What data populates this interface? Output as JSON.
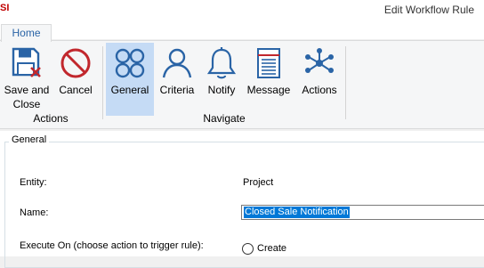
{
  "app": {
    "logo": "SI",
    "window_title": "Edit Workflow Rule"
  },
  "tabs": [
    {
      "label": "Home"
    }
  ],
  "ribbon": {
    "groups": {
      "actions": {
        "label": "Actions",
        "buttons": {
          "save_close": {
            "line1": "Save and",
            "line2": "Close",
            "icon": "save-close-icon"
          },
          "cancel": {
            "label": "Cancel",
            "icon": "cancel-icon"
          }
        }
      },
      "navigate": {
        "label": "Navigate",
        "buttons": {
          "general": {
            "label": "General",
            "icon": "general-icon",
            "selected": true
          },
          "criteria": {
            "label": "Criteria",
            "icon": "person-icon"
          },
          "notify": {
            "label": "Notify",
            "icon": "bell-icon"
          },
          "message": {
            "label": "Message",
            "icon": "message-icon"
          },
          "actions": {
            "label": "Actions",
            "icon": "network-icon"
          }
        }
      }
    }
  },
  "form": {
    "section_title": "General",
    "entity": {
      "label": "Entity:",
      "value": "Project"
    },
    "name": {
      "label": "Name:",
      "value": "Closed Sale Notification"
    },
    "execute_on": {
      "label": "Execute On (choose action to trigger rule):",
      "option": "Create"
    }
  },
  "colors": {
    "accent": "#2a64a6",
    "selected_bg": "#c5dbf5",
    "cancel_red": "#c1272d",
    "selection_blue": "#0078d7"
  }
}
